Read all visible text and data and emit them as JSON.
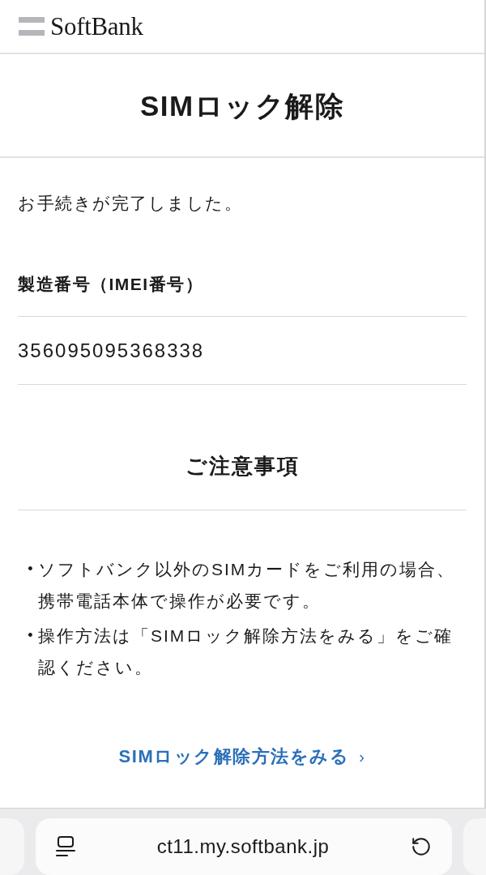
{
  "header": {
    "logo_text": "SoftBank"
  },
  "page_title": "SIMロック解除",
  "message": "お手続きが完了しました。",
  "imei": {
    "label": "製造番号（IMEI番号）",
    "value": "356095095368338"
  },
  "notes": {
    "heading": "ご注意事項",
    "items": [
      {
        "marker": "•",
        "text": "ソフトバンク以外のSIMカードをご利用の場合、携帯電話本体で操作が必要です。"
      },
      {
        "marker": "•",
        "text": "操作方法は「SIMロック解除方法をみる」をご確認ください。"
      }
    ]
  },
  "link": {
    "label": "SIMロック解除方法をみる",
    "arrow": "›"
  },
  "browser_bar": {
    "url": "ct11.my.softbank.jp"
  }
}
